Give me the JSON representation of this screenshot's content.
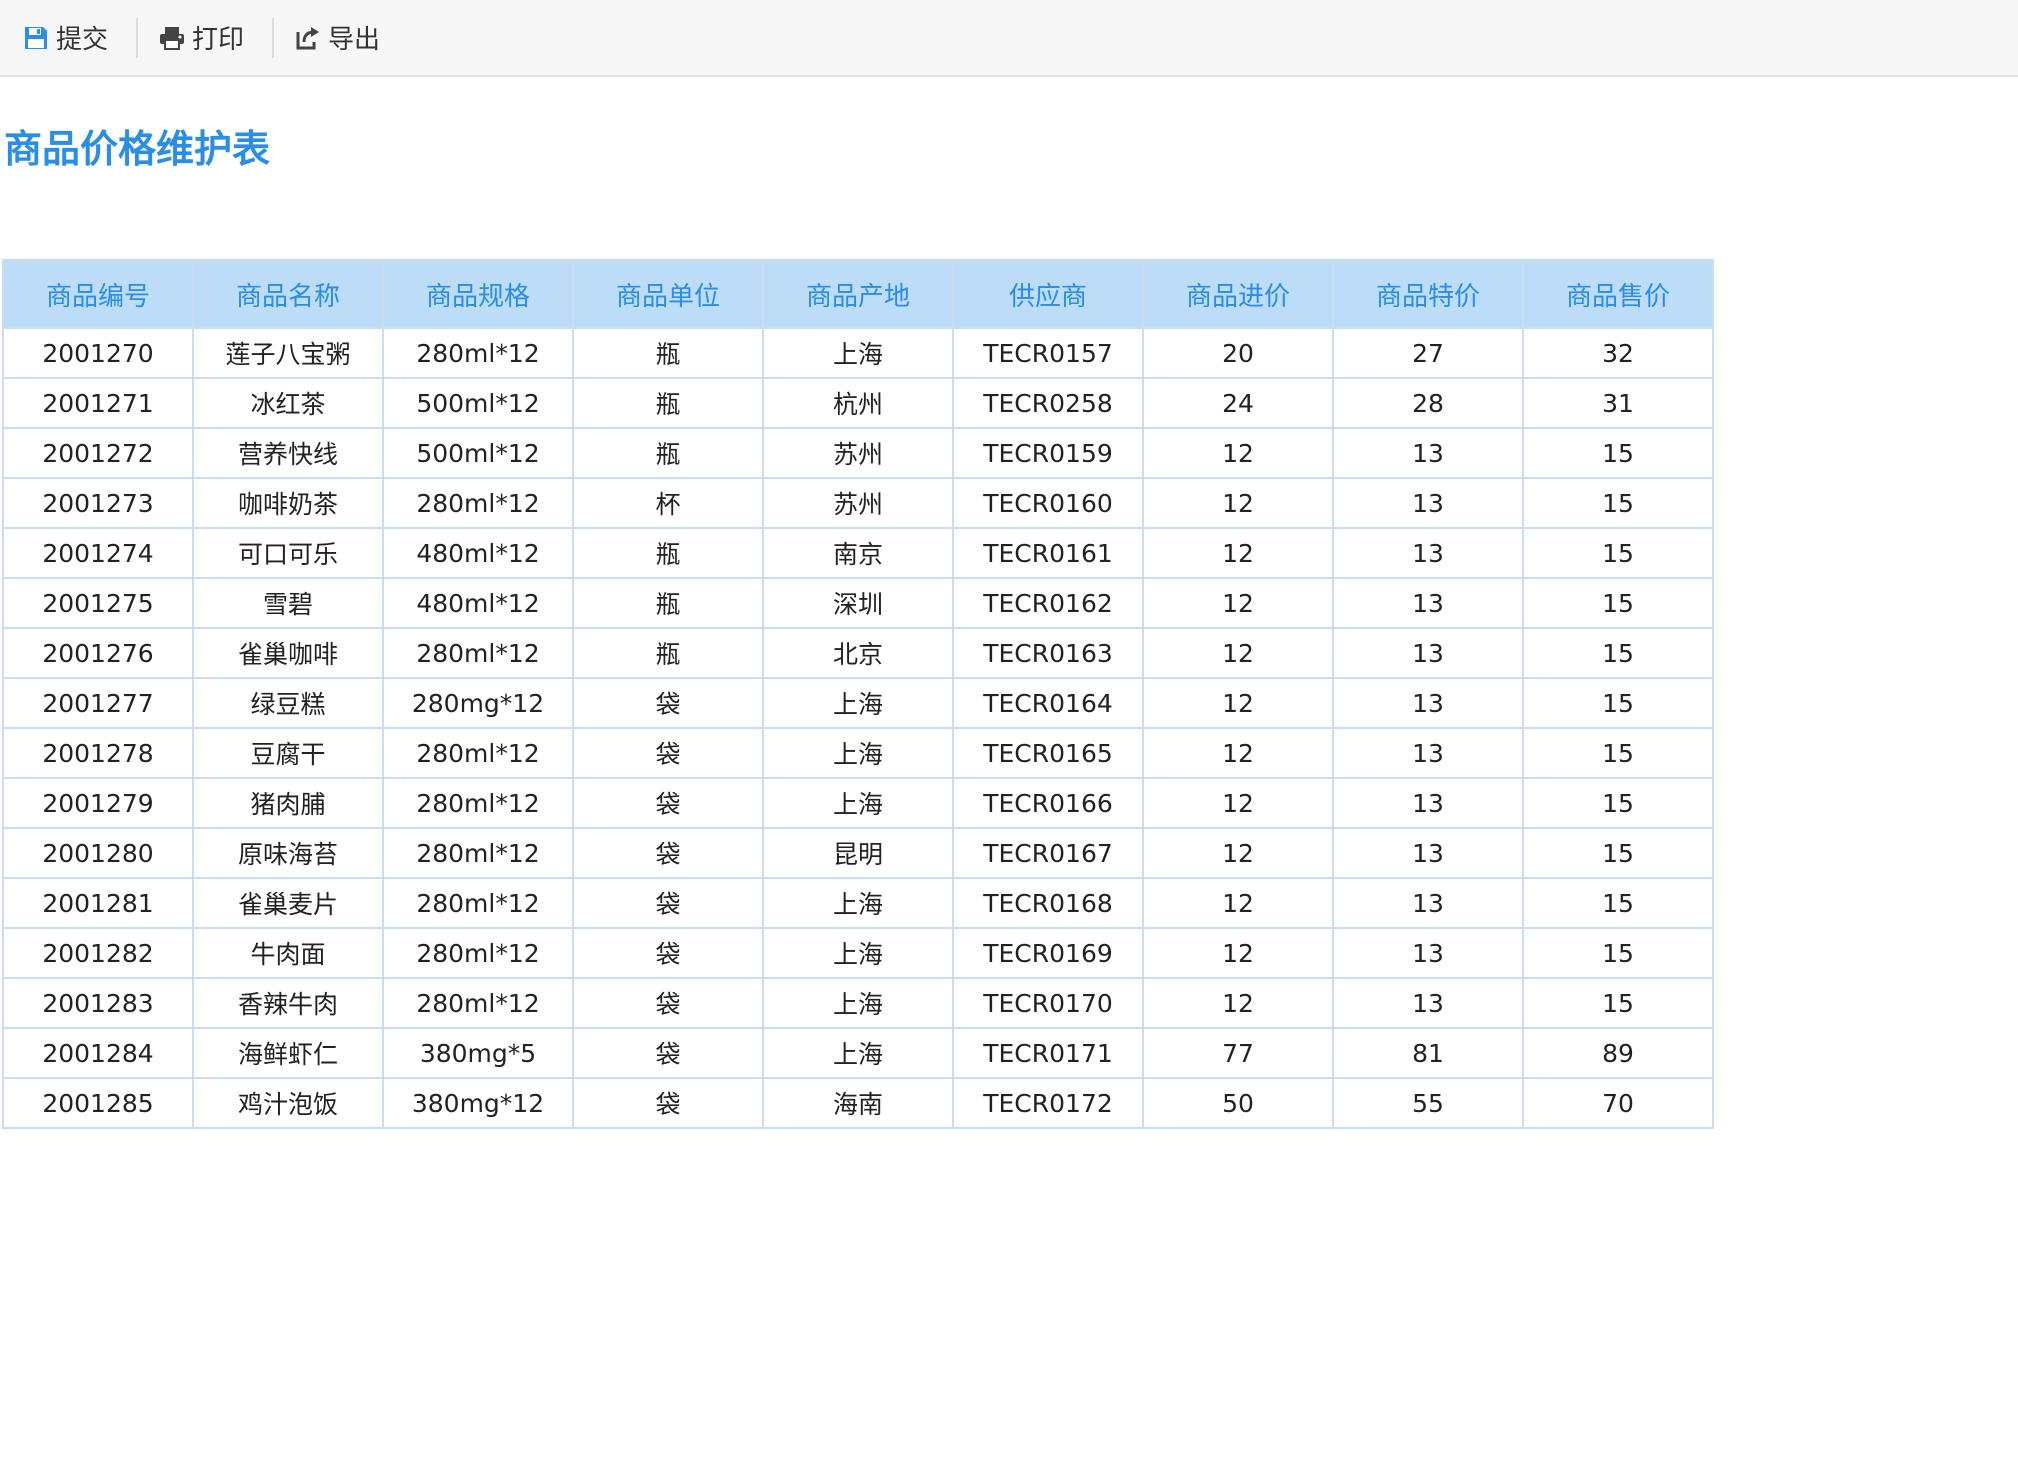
{
  "toolbar": {
    "submit_label": "提交",
    "print_label": "打印",
    "export_label": "导出",
    "submit_icon": "save-icon",
    "print_icon": "printer-icon",
    "export_icon": "export-icon",
    "icon_color": "#2a8ee8"
  },
  "title": "商品价格维护表",
  "table": {
    "headers": [
      "商品编号",
      "商品名称",
      "商品规格",
      "商品单位",
      "商品产地",
      "供应商",
      "商品进价",
      "商品特价",
      "商品售价"
    ],
    "rows": [
      [
        "2001270",
        "莲子八宝粥",
        "280ml*12",
        "瓶",
        "上海",
        "TECR0157",
        "20",
        "27",
        "32"
      ],
      [
        "2001271",
        "冰红茶",
        "500ml*12",
        "瓶",
        "杭州",
        "TECR0258",
        "24",
        "28",
        "31"
      ],
      [
        "2001272",
        "营养快线",
        "500ml*12",
        "瓶",
        "苏州",
        "TECR0159",
        "12",
        "13",
        "15"
      ],
      [
        "2001273",
        "咖啡奶茶",
        "280ml*12",
        "杯",
        "苏州",
        "TECR0160",
        "12",
        "13",
        "15"
      ],
      [
        "2001274",
        "可口可乐",
        "480ml*12",
        "瓶",
        "南京",
        "TECR0161",
        "12",
        "13",
        "15"
      ],
      [
        "2001275",
        "雪碧",
        "480ml*12",
        "瓶",
        "深圳",
        "TECR0162",
        "12",
        "13",
        "15"
      ],
      [
        "2001276",
        "雀巢咖啡",
        "280ml*12",
        "瓶",
        "北京",
        "TECR0163",
        "12",
        "13",
        "15"
      ],
      [
        "2001277",
        "绿豆糕",
        "280mg*12",
        "袋",
        "上海",
        "TECR0164",
        "12",
        "13",
        "15"
      ],
      [
        "2001278",
        "豆腐干",
        "280ml*12",
        "袋",
        "上海",
        "TECR0165",
        "12",
        "13",
        "15"
      ],
      [
        "2001279",
        "猪肉脯",
        "280ml*12",
        "袋",
        "上海",
        "TECR0166",
        "12",
        "13",
        "15"
      ],
      [
        "2001280",
        "原味海苔",
        "280ml*12",
        "袋",
        "昆明",
        "TECR0167",
        "12",
        "13",
        "15"
      ],
      [
        "2001281",
        "雀巢麦片",
        "280ml*12",
        "袋",
        "上海",
        "TECR0168",
        "12",
        "13",
        "15"
      ],
      [
        "2001282",
        "牛肉面",
        "280ml*12",
        "袋",
        "上海",
        "TECR0169",
        "12",
        "13",
        "15"
      ],
      [
        "2001283",
        "香辣牛肉",
        "280ml*12",
        "袋",
        "上海",
        "TECR0170",
        "12",
        "13",
        "15"
      ],
      [
        "2001284",
        "海鲜虾仁",
        "380mg*5",
        "袋",
        "上海",
        "TECR0171",
        "77",
        "81",
        "89"
      ],
      [
        "2001285",
        "鸡汁泡饭",
        "380mg*12",
        "袋",
        "海南",
        "TECR0172",
        "50",
        "55",
        "70"
      ]
    ]
  }
}
